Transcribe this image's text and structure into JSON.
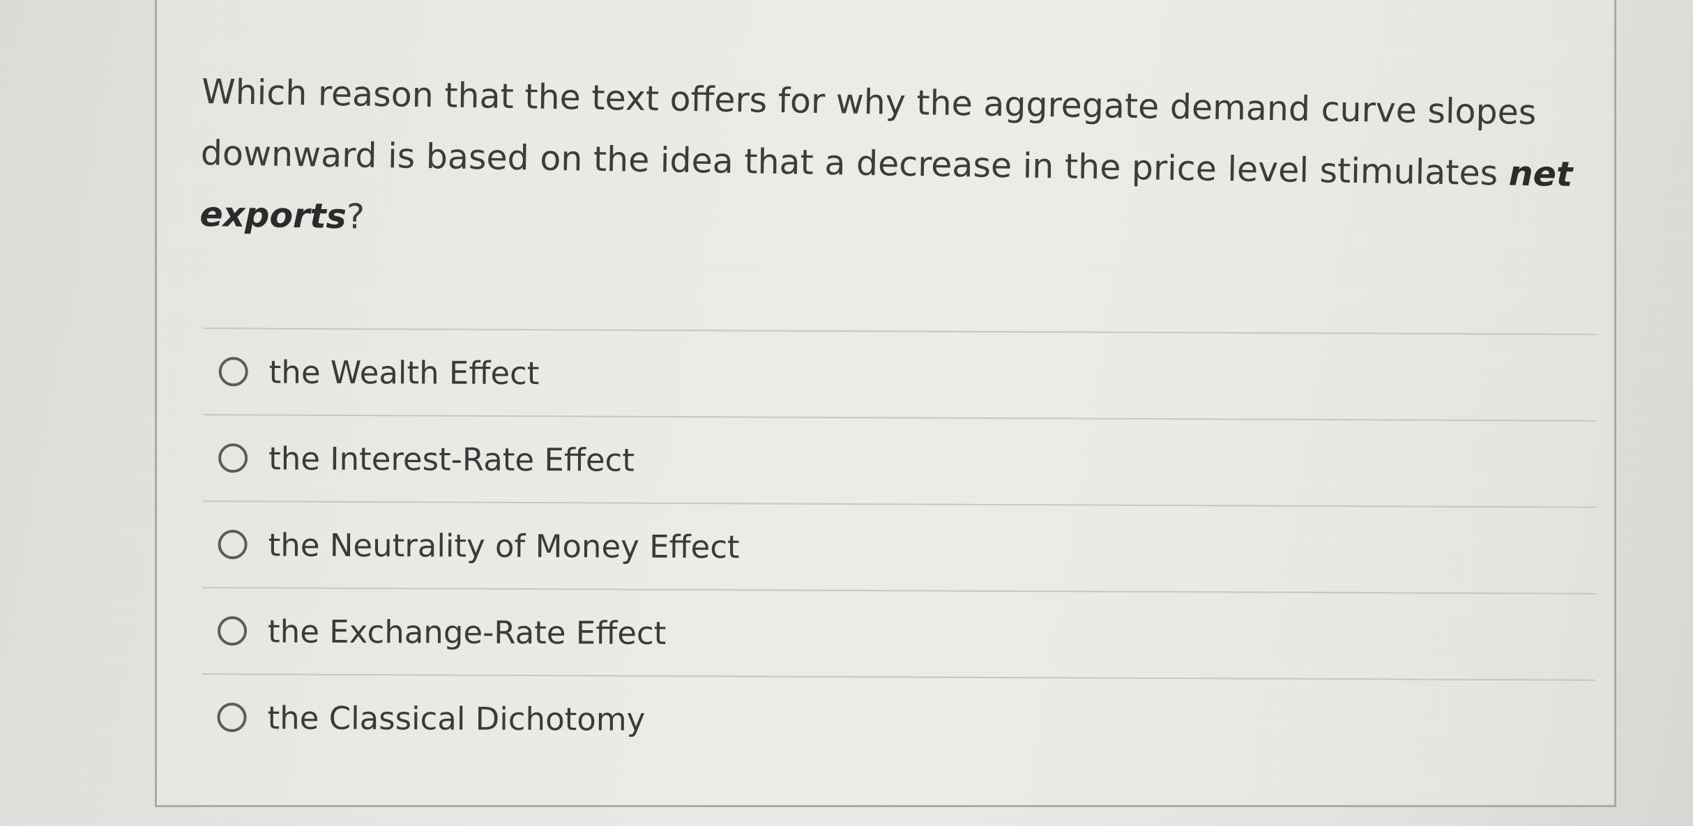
{
  "question": {
    "text_part1": "Which reason that the text offers for why the aggregate demand curve slopes downward is based on the idea that a decrease in the price level stimulates ",
    "emphasis": "net exports",
    "text_end": "?"
  },
  "options": [
    {
      "label": "the Wealth Effect"
    },
    {
      "label": "the Interest-Rate Effect"
    },
    {
      "label": "the Neutrality of Money Effect"
    },
    {
      "label": "the Exchange-Rate Effect"
    },
    {
      "label": "the Classical Dichotomy"
    }
  ]
}
